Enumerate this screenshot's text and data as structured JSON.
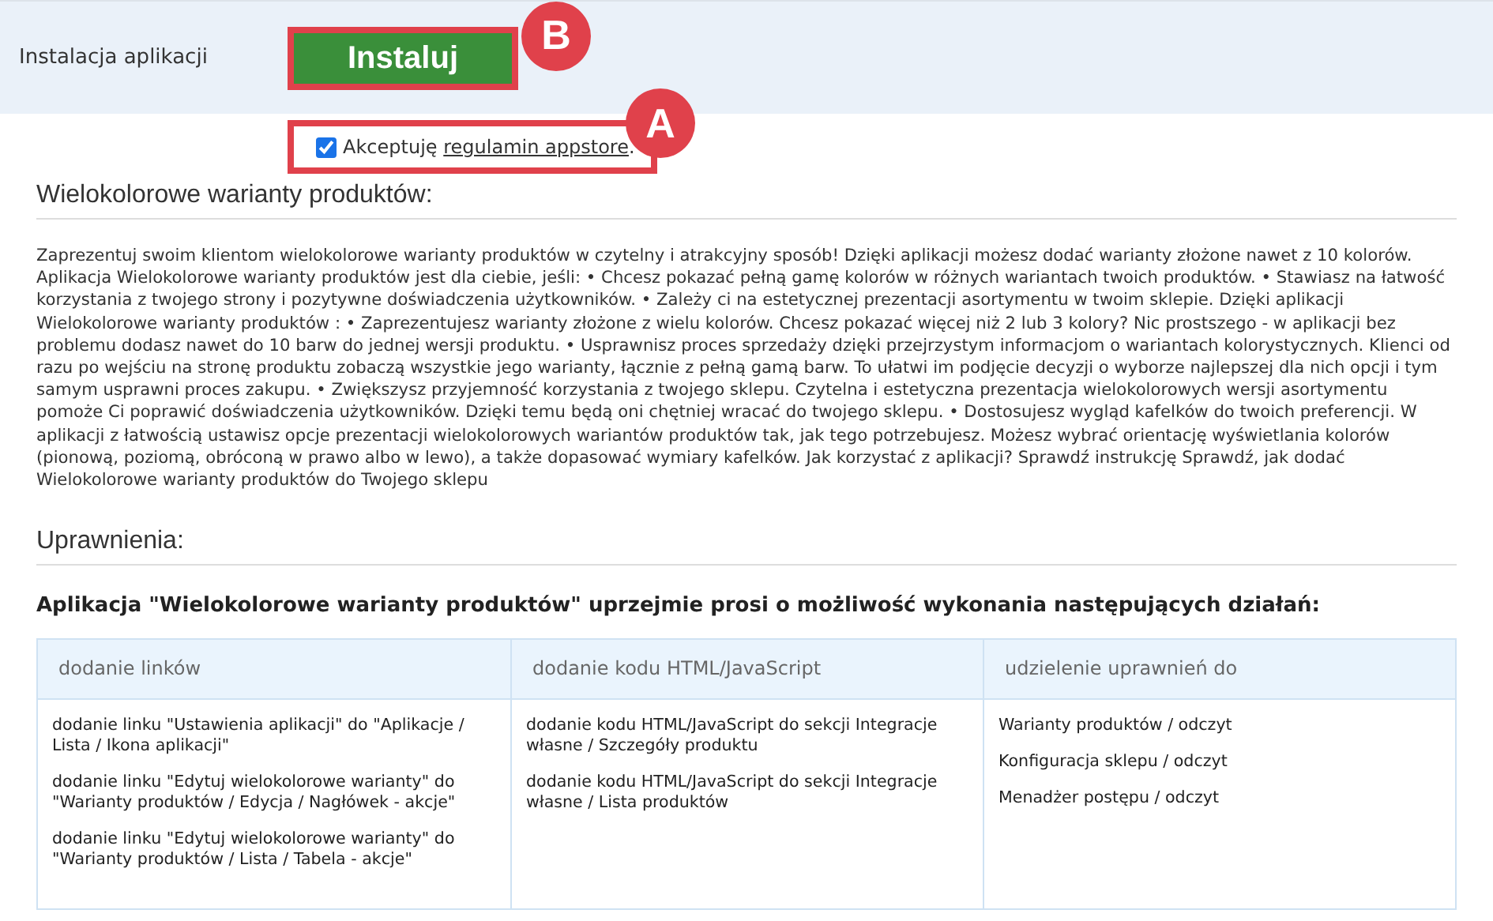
{
  "install_bar": {
    "label": "Instalacja aplikacji",
    "button": "Instaluj",
    "button_marker": "B"
  },
  "terms": {
    "checked": true,
    "prefix": "Akceptuję",
    "link": "regulamin appstore",
    "suffix": ".",
    "marker": "A"
  },
  "description": {
    "heading": "Wielokolorowe warianty produktów:",
    "text": "Zaprezentuj swoim klientom wielokolorowe warianty produktów w czytelny i atrakcyjny sposób! Dzięki aplikacji możesz dodać warianty złożone nawet z 10 kolorów. Aplikacja Wielokolorowe warianty produktów jest dla ciebie, jeśli: • Chcesz pokazać pełną gamę kolorów w różnych wariantach twoich produktów. • Stawiasz na łatwość korzystania z twojego strony i pozytywne doświadczenia użytkowników. • Zależy ci na estetycznej prezentacji asortymentu w twoim sklepie. Dzięki aplikacji Wielokolorowe warianty produktów : • Zaprezentujesz warianty złożone z wielu kolorów. Chcesz pokazać więcej niż 2 lub 3 kolory? Nic prostszego - w aplikacji bez problemu dodasz nawet do 10 barw do jednej wersji produktu. • Usprawnisz proces sprzedaży dzięki przejrzystym informacjom o wariantach kolorystycznych. Klienci od razu po wejściu na stronę produktu zobaczą wszystkie jego warianty, łącznie z pełną gamą barw. To ułatwi im podjęcie decyzji o wyborze najlepszej dla nich opcji i tym samym usprawni proces zakupu. • Zwiększysz przyjemność korzystania z twojego sklepu. Czytelna i estetyczna prezentacja wielokolorowych wersji asortymentu pomoże Ci poprawić doświadczenia użytkowników. Dzięki temu będą oni chętniej wracać do twojego sklepu. • Dostosujesz wygląd kafelków do twoich preferencji. W aplikacji z łatwością ustawisz opcje prezentacji wielokolorowych wariantów produktów tak, jak tego potrzebujesz. Możesz wybrać orientację wyświetlania kolorów (pionową, poziomą, obróconą w prawo albo w lewo), a także dopasować wymiary kafelków. Jak korzystać z aplikacji? Sprawdź instrukcję Sprawdź, jak dodać Wielokolorowe warianty produktów do Twojego sklepu"
  },
  "permissions": {
    "heading": "Uprawnienia:",
    "request": "Aplikacja \"Wielokolorowe warianty produktów\" uprzejmie prosi o możliwość wykonania następujących działań:",
    "columns": [
      {
        "header": "dodanie linków",
        "items": [
          "dodanie linku \"Ustawienia aplikacji\" do \"Aplikacje / Lista / Ikona aplikacji\"",
          "dodanie linku \"Edytuj wielokolorowe warianty\" do \"Warianty produktów / Edycja / Nagłówek - akcje\"",
          "dodanie linku \"Edytuj wielokolorowe warianty\" do \"Warianty produktów / Lista / Tabela - akcje\""
        ]
      },
      {
        "header": "dodanie kodu HTML/JavaScript",
        "items": [
          "dodanie kodu HTML/JavaScript do sekcji Integracje własne / Szczegóły produktu",
          "dodanie kodu HTML/JavaScript do sekcji Integracje własne / Lista produktów"
        ]
      },
      {
        "header": "udzielenie uprawnień do",
        "items": [
          "Warianty produktów / odczyt",
          "Konfiguracja sklepu / odczyt",
          "Menadżer postępu / odczyt"
        ]
      }
    ]
  }
}
